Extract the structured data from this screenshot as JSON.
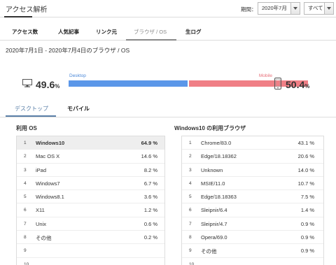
{
  "header": {
    "title": "アクセス解析",
    "period_label": "期間：",
    "period_value": "2020年7月",
    "scope_value": "すべて"
  },
  "tabs": [
    {
      "label": "アクセス数"
    },
    {
      "label": "人気記事"
    },
    {
      "label": "リンク元"
    },
    {
      "label": "ブラウザ / OS"
    },
    {
      "label": "生ログ"
    }
  ],
  "active_tab": "ブラウザ / OS",
  "date_range": "2020年7月1日 - 2020年7月4日のブラウザ / OS",
  "device_ratio": {
    "desktop_label": "Desktop",
    "mobile_label": "Mobile",
    "desktop_pct": "49.6",
    "mobile_pct": "50.4",
    "pct_unit": "%",
    "desktop_fraction": 0.496,
    "mobile_fraction": 0.504,
    "desktop_color": "#5b97e9",
    "mobile_color": "#f07f86",
    "desktop_icon": "monitor-icon",
    "mobile_icon": "smartphone-icon"
  },
  "device_tabs": [
    {
      "label": "デスクトップ"
    },
    {
      "label": "モバイル"
    }
  ],
  "os_panel": {
    "title": "利用 OS",
    "rows": [
      {
        "num": "1",
        "name": "Windows10",
        "value": "64.9 %"
      },
      {
        "num": "2",
        "name": "Mac OS X",
        "value": "14.6 %"
      },
      {
        "num": "3",
        "name": "iPad",
        "value": "8.2 %"
      },
      {
        "num": "4",
        "name": "Windows7",
        "value": "6.7 %"
      },
      {
        "num": "5",
        "name": "Windows8.1",
        "value": "3.6 %"
      },
      {
        "num": "6",
        "name": "X11",
        "value": "1.2 %"
      },
      {
        "num": "7",
        "name": "Unix",
        "value": "0.6 %"
      },
      {
        "num": "8",
        "name": "その他",
        "value": "0.2 %"
      },
      {
        "num": "9",
        "name": "",
        "value": ""
      },
      {
        "num": "10",
        "name": "",
        "value": ""
      }
    ]
  },
  "browser_panel": {
    "title": "Windows10 の利用ブラウザ",
    "rows": [
      {
        "num": "1",
        "name": "Chrome/83.0",
        "value": "43.1 %"
      },
      {
        "num": "2",
        "name": "Edge/18.18362",
        "value": "20.6 %"
      },
      {
        "num": "3",
        "name": "Unknown",
        "value": "14.0 %"
      },
      {
        "num": "4",
        "name": "MSIE/11.0",
        "value": "10.7 %"
      },
      {
        "num": "5",
        "name": "Edge/18.18363",
        "value": "7.5 %"
      },
      {
        "num": "6",
        "name": "Sleipnir/6.4",
        "value": "1.4 %"
      },
      {
        "num": "7",
        "name": "Sleipnir/4.7",
        "value": "0.9 %"
      },
      {
        "num": "8",
        "name": "Opera/69.0",
        "value": "0.9 %"
      },
      {
        "num": "9",
        "name": "その他",
        "value": "0.9 %"
      },
      {
        "num": "10",
        "name": "",
        "value": ""
      }
    ]
  }
}
